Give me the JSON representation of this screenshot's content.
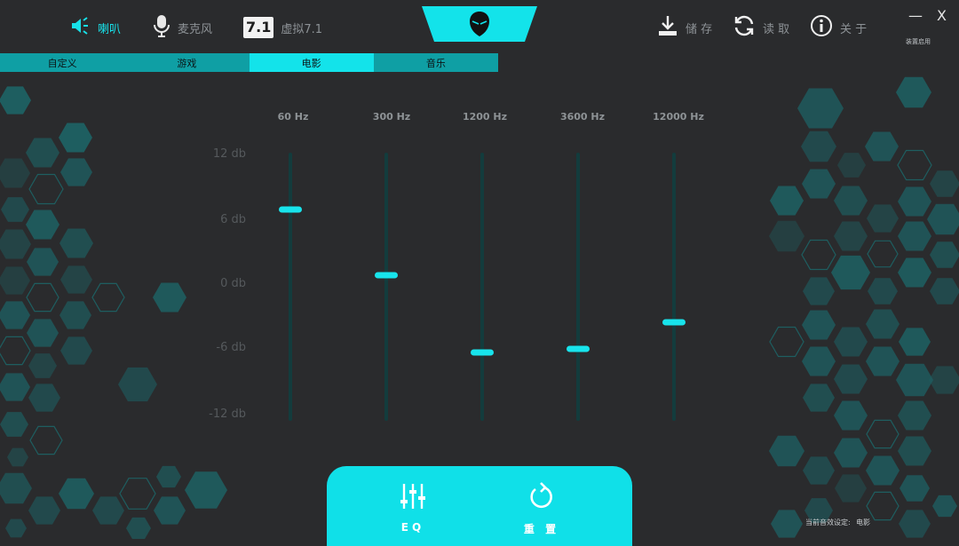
{
  "top_nav": {
    "speaker_label": "喇叭",
    "mic_label": "麦克风",
    "virtual_badge": "7.1",
    "virtual_label": "虚拟7.1",
    "save_label": "储 存",
    "load_label": "读 取",
    "about_label": "关 于",
    "minimize": "—",
    "close": "X",
    "device_label": "装置启用"
  },
  "presets": {
    "selected": "电影",
    "items": [
      "自定义",
      "游戏",
      "电影",
      "音乐"
    ]
  },
  "eq": {
    "db_labels": [
      "12 db",
      "6 db",
      "0 db",
      "-6 db",
      "-12 db"
    ],
    "bands": [
      {
        "freq": "60 Hz",
        "gain_db": 7
      },
      {
        "freq": "300 Hz",
        "gain_db": 1
      },
      {
        "freq": "1200 Hz",
        "gain_db": -6
      },
      {
        "freq": "3600 Hz",
        "gain_db": -5.7
      },
      {
        "freq": "12000 Hz",
        "gain_db": -3.3
      }
    ],
    "range": [
      -12,
      12
    ]
  },
  "bottom": {
    "eq_label": "EQ",
    "reset_label": "重 置"
  },
  "status": {
    "label": "当前音效设定:",
    "value": "电影"
  },
  "colors": {
    "accent": "#13e3ea",
    "background": "#2a2b2d",
    "hex_fill": "#1e5e60"
  }
}
